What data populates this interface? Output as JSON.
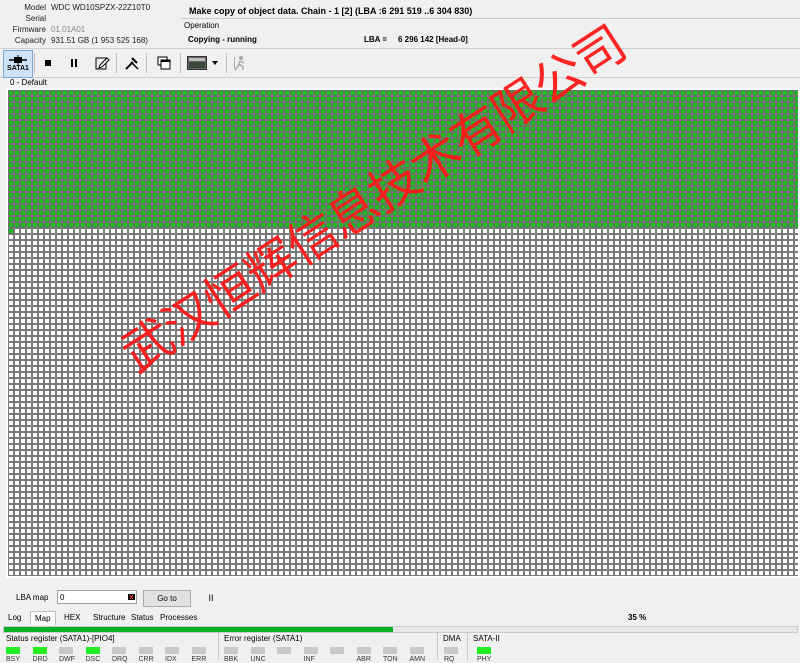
{
  "device": {
    "labels": {
      "model": "Model",
      "serial": "Serial",
      "firmware": "Firmware",
      "capacity": "Capacity"
    },
    "model": "WDC WD10SPZX-22Z10T0",
    "serial": "",
    "firmware": "01.01A01",
    "capacity": "931.51 GB (1 953 525 168)"
  },
  "operation": {
    "title": "Make copy of object data. Chain - 1 [2] (LBA :6 291 519 ..6 304 830)",
    "section_label": "Operation",
    "state": "Copying - running",
    "lba_label": "LBA =",
    "lba_value": "6 296 142  [Head-0]"
  },
  "toolbar": {
    "port_label": "SATA1",
    "icons": [
      "sata-port-icon",
      "stop-icon",
      "pause-icon",
      "edit-document-icon",
      "tools-icon",
      "copy-windows-icon",
      "screen-thumbnail-icon",
      "dropdown-arrow-icon",
      "exit-figure-icon"
    ]
  },
  "map": {
    "caption": "0 - Default",
    "columns": 132,
    "rows": 81,
    "completed_rows": 23,
    "completed_extra_cells": 1,
    "done_color": "#22bb22",
    "pending_color": "#ffffff",
    "cell_border": "#5a5a5a"
  },
  "watermark": "武汉恒辉信息技术有限公司",
  "lba_map": {
    "label": "LBA map",
    "value": "0",
    "goto_label": "Go to",
    "pause_glyph": "II"
  },
  "tabs": [
    "Log",
    "Map",
    "HEX",
    "Structure",
    "Status",
    "Processes"
  ],
  "active_tab": "Map",
  "progress": {
    "percent_text": "35 %",
    "fraction": 0.49,
    "color": "#06b025"
  },
  "registers": {
    "status": {
      "title": "Status register (SATA1)-[PIO4]",
      "bits": [
        {
          "name": "BSY",
          "on": true
        },
        {
          "name": "DRD",
          "on": true
        },
        {
          "name": "DWF",
          "on": false
        },
        {
          "name": "DSC",
          "on": true
        },
        {
          "name": "DRQ",
          "on": false
        },
        {
          "name": "CRR",
          "on": false
        },
        {
          "name": "IDX",
          "on": false
        },
        {
          "name": "ERR",
          "on": false
        }
      ]
    },
    "error": {
      "title": "Error register (SATA1)",
      "bits": [
        {
          "name": "BBK",
          "on": false
        },
        {
          "name": "UNC",
          "on": false
        },
        {
          "name": "",
          "on": false
        },
        {
          "name": "INF",
          "on": false
        },
        {
          "name": "",
          "on": false
        },
        {
          "name": "ABR",
          "on": false
        },
        {
          "name": "TON",
          "on": false
        },
        {
          "name": "AMN",
          "on": false
        }
      ]
    },
    "dma": {
      "title": "DMA",
      "bits": [
        {
          "name": "RQ",
          "on": false
        }
      ]
    },
    "sata2": {
      "title": "SATA-II",
      "bits": [
        {
          "name": "PHY",
          "on": true
        }
      ]
    },
    "led_on_color": "#22ee22",
    "led_off_color": "#c8c8c8"
  }
}
